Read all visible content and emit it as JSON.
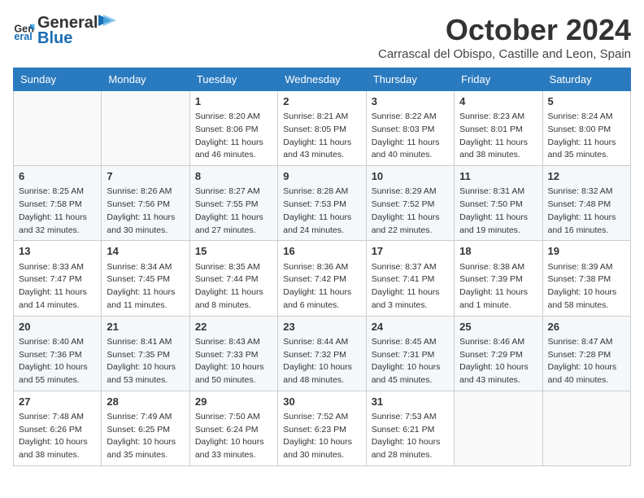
{
  "logo": {
    "line1": "General",
    "line2": "Blue"
  },
  "title": "October 2024",
  "location": "Carrascal del Obispo, Castille and Leon, Spain",
  "days_of_week": [
    "Sunday",
    "Monday",
    "Tuesday",
    "Wednesday",
    "Thursday",
    "Friday",
    "Saturday"
  ],
  "weeks": [
    [
      {
        "day": "",
        "info": ""
      },
      {
        "day": "",
        "info": ""
      },
      {
        "day": "1",
        "info": "Sunrise: 8:20 AM\nSunset: 8:06 PM\nDaylight: 11 hours and 46 minutes."
      },
      {
        "day": "2",
        "info": "Sunrise: 8:21 AM\nSunset: 8:05 PM\nDaylight: 11 hours and 43 minutes."
      },
      {
        "day": "3",
        "info": "Sunrise: 8:22 AM\nSunset: 8:03 PM\nDaylight: 11 hours and 40 minutes."
      },
      {
        "day": "4",
        "info": "Sunrise: 8:23 AM\nSunset: 8:01 PM\nDaylight: 11 hours and 38 minutes."
      },
      {
        "day": "5",
        "info": "Sunrise: 8:24 AM\nSunset: 8:00 PM\nDaylight: 11 hours and 35 minutes."
      }
    ],
    [
      {
        "day": "6",
        "info": "Sunrise: 8:25 AM\nSunset: 7:58 PM\nDaylight: 11 hours and 32 minutes."
      },
      {
        "day": "7",
        "info": "Sunrise: 8:26 AM\nSunset: 7:56 PM\nDaylight: 11 hours and 30 minutes."
      },
      {
        "day": "8",
        "info": "Sunrise: 8:27 AM\nSunset: 7:55 PM\nDaylight: 11 hours and 27 minutes."
      },
      {
        "day": "9",
        "info": "Sunrise: 8:28 AM\nSunset: 7:53 PM\nDaylight: 11 hours and 24 minutes."
      },
      {
        "day": "10",
        "info": "Sunrise: 8:29 AM\nSunset: 7:52 PM\nDaylight: 11 hours and 22 minutes."
      },
      {
        "day": "11",
        "info": "Sunrise: 8:31 AM\nSunset: 7:50 PM\nDaylight: 11 hours and 19 minutes."
      },
      {
        "day": "12",
        "info": "Sunrise: 8:32 AM\nSunset: 7:48 PM\nDaylight: 11 hours and 16 minutes."
      }
    ],
    [
      {
        "day": "13",
        "info": "Sunrise: 8:33 AM\nSunset: 7:47 PM\nDaylight: 11 hours and 14 minutes."
      },
      {
        "day": "14",
        "info": "Sunrise: 8:34 AM\nSunset: 7:45 PM\nDaylight: 11 hours and 11 minutes."
      },
      {
        "day": "15",
        "info": "Sunrise: 8:35 AM\nSunset: 7:44 PM\nDaylight: 11 hours and 8 minutes."
      },
      {
        "day": "16",
        "info": "Sunrise: 8:36 AM\nSunset: 7:42 PM\nDaylight: 11 hours and 6 minutes."
      },
      {
        "day": "17",
        "info": "Sunrise: 8:37 AM\nSunset: 7:41 PM\nDaylight: 11 hours and 3 minutes."
      },
      {
        "day": "18",
        "info": "Sunrise: 8:38 AM\nSunset: 7:39 PM\nDaylight: 11 hours and 1 minute."
      },
      {
        "day": "19",
        "info": "Sunrise: 8:39 AM\nSunset: 7:38 PM\nDaylight: 10 hours and 58 minutes."
      }
    ],
    [
      {
        "day": "20",
        "info": "Sunrise: 8:40 AM\nSunset: 7:36 PM\nDaylight: 10 hours and 55 minutes."
      },
      {
        "day": "21",
        "info": "Sunrise: 8:41 AM\nSunset: 7:35 PM\nDaylight: 10 hours and 53 minutes."
      },
      {
        "day": "22",
        "info": "Sunrise: 8:43 AM\nSunset: 7:33 PM\nDaylight: 10 hours and 50 minutes."
      },
      {
        "day": "23",
        "info": "Sunrise: 8:44 AM\nSunset: 7:32 PM\nDaylight: 10 hours and 48 minutes."
      },
      {
        "day": "24",
        "info": "Sunrise: 8:45 AM\nSunset: 7:31 PM\nDaylight: 10 hours and 45 minutes."
      },
      {
        "day": "25",
        "info": "Sunrise: 8:46 AM\nSunset: 7:29 PM\nDaylight: 10 hours and 43 minutes."
      },
      {
        "day": "26",
        "info": "Sunrise: 8:47 AM\nSunset: 7:28 PM\nDaylight: 10 hours and 40 minutes."
      }
    ],
    [
      {
        "day": "27",
        "info": "Sunrise: 7:48 AM\nSunset: 6:26 PM\nDaylight: 10 hours and 38 minutes."
      },
      {
        "day": "28",
        "info": "Sunrise: 7:49 AM\nSunset: 6:25 PM\nDaylight: 10 hours and 35 minutes."
      },
      {
        "day": "29",
        "info": "Sunrise: 7:50 AM\nSunset: 6:24 PM\nDaylight: 10 hours and 33 minutes."
      },
      {
        "day": "30",
        "info": "Sunrise: 7:52 AM\nSunset: 6:23 PM\nDaylight: 10 hours and 30 minutes."
      },
      {
        "day": "31",
        "info": "Sunrise: 7:53 AM\nSunset: 6:21 PM\nDaylight: 10 hours and 28 minutes."
      },
      {
        "day": "",
        "info": ""
      },
      {
        "day": "",
        "info": ""
      }
    ]
  ]
}
